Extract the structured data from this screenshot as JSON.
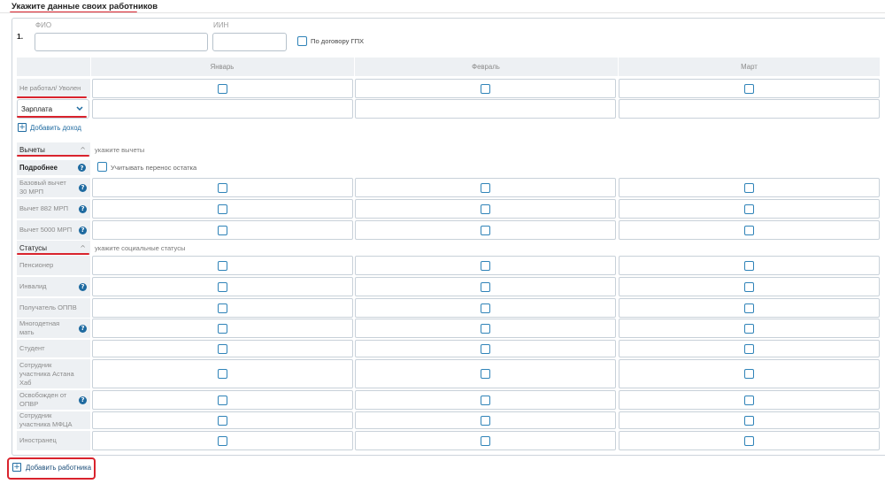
{
  "page": {
    "title": "Укажите данные своих работников"
  },
  "employee": {
    "number": "1.",
    "fio_label": "ФИО",
    "fio_value": "",
    "iin_label": "ИИН",
    "iin_value": "",
    "gph_label": "По договору ГПХ",
    "gph_checked": false
  },
  "months": [
    "Январь",
    "Февраль",
    "Март"
  ],
  "income": {
    "fired_label": "Не работал/ Уволен",
    "type_select": "Зарплата",
    "add_income": "Добавить доход"
  },
  "deductions": {
    "header": "Вычеты",
    "hint": "укажите вычеты",
    "more_label": "Подробнее",
    "carry_label": "Учитывать перенос остатка",
    "rows": [
      {
        "label": "Базовый вычет 30 МРП",
        "label_lines": [
          "Базовый вычет",
          "30 МРП"
        ],
        "help": true
      },
      {
        "label": "Вычет 882 МРП",
        "label_lines": [
          "Вычет 882 МРП"
        ],
        "help": true
      },
      {
        "label": "Вычет 5000 МРП",
        "label_lines": [
          "Вычет 5000 МРП"
        ],
        "help": true
      }
    ]
  },
  "statuses": {
    "header": "Статусы",
    "hint": "укажите социальные статусы",
    "rows": [
      {
        "label": "Пенсионер",
        "label_lines": [
          "Пенсионер"
        ],
        "help": false
      },
      {
        "label": "Инвалид",
        "label_lines": [
          "Инвалид"
        ],
        "help": true
      },
      {
        "label": "Получатель ОППВ",
        "label_lines": [
          "Получатель ОППВ"
        ],
        "help": false
      },
      {
        "label": "Многодетная мать",
        "label_lines": [
          "Многодетная",
          "мать"
        ],
        "help": true
      },
      {
        "label": "Студент",
        "label_lines": [
          "Студент"
        ],
        "help": false
      },
      {
        "label": "Сотрудник участника Астана Хаб",
        "label_lines": [
          "Сотрудник",
          "участника Астана",
          "Хаб"
        ],
        "help": false
      },
      {
        "label": "Освобожден от ОПВР",
        "label_lines": [
          "Освобожден от",
          "ОПВР"
        ],
        "help": true
      },
      {
        "label": "Сотрудник участника МФЦА",
        "label_lines": [
          "Сотрудник",
          "участника МФЦА"
        ],
        "help": false
      },
      {
        "label": "Иностранец",
        "label_lines": [
          "Иностранец"
        ],
        "help": false
      }
    ]
  },
  "add_employee": "Добавить работника",
  "colors": {
    "accent": "#1e6aa0",
    "checkbox": "#2f83b8",
    "highlight": "#d9232d",
    "row_bg": "#edf0f3"
  }
}
